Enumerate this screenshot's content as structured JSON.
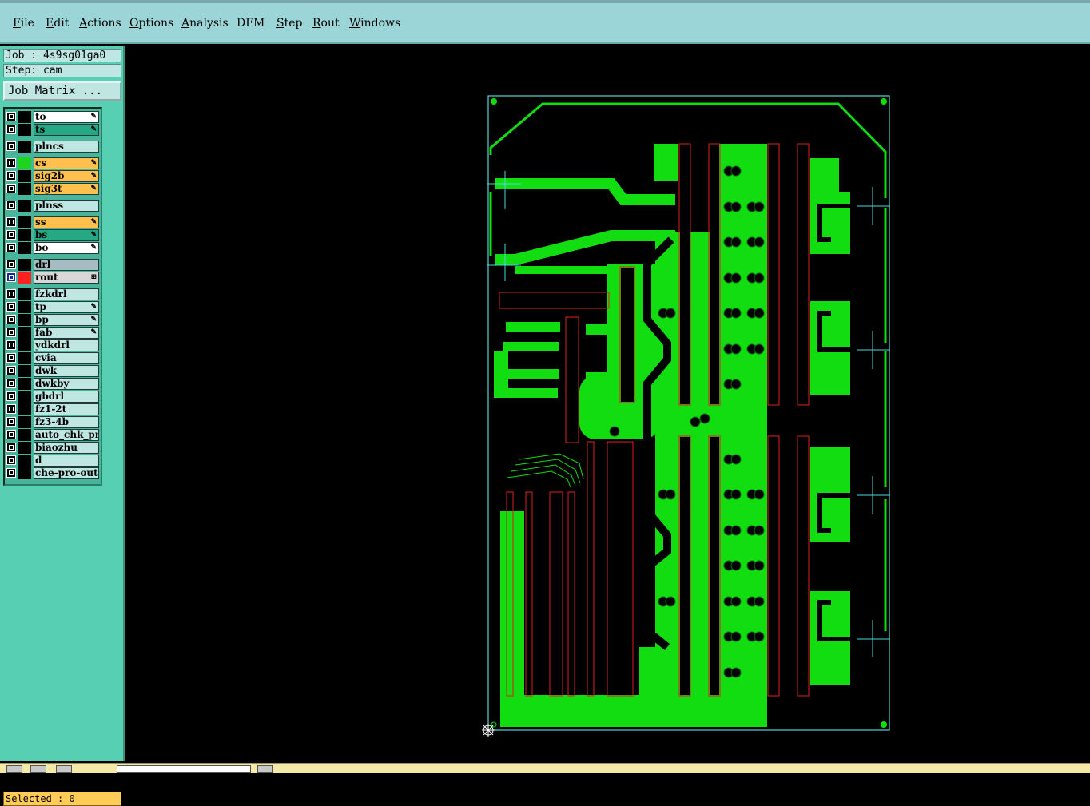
{
  "menubar": {
    "items": [
      {
        "label": "File",
        "accel": "F"
      },
      {
        "label": "Edit",
        "accel": "E"
      },
      {
        "label": "Actions",
        "accel": "A"
      },
      {
        "label": "Options",
        "accel": "O"
      },
      {
        "label": "Analysis",
        "accel": "A"
      },
      {
        "label": "DFM",
        "accel": ""
      },
      {
        "label": "Step",
        "accel": "S"
      },
      {
        "label": "Rout",
        "accel": "R"
      },
      {
        "label": "Windows",
        "accel": "W"
      }
    ]
  },
  "sidebar": {
    "job_label": "Job : 4s9sg01ga0",
    "step_label": "Step: cam",
    "job_matrix_button": "Job Matrix ...",
    "layers": [
      {
        "name": "to",
        "bg": "#ffffff",
        "swatch": "#000000",
        "icon": "pen-icon",
        "group": 0
      },
      {
        "name": "ts",
        "bg": "#27a884",
        "swatch": "#000000",
        "icon": "pen-icon",
        "group": 0
      },
      {
        "name": "plncs",
        "bg": "#bfe6e2",
        "swatch": "#000000",
        "icon": "",
        "group": 1
      },
      {
        "name": "cs",
        "bg": "#ffc04d",
        "swatch": "#1fd41f",
        "icon": "pen-icon",
        "group": 2
      },
      {
        "name": "sig2b",
        "bg": "#ffc04d",
        "swatch": "#000000",
        "icon": "pen-icon",
        "group": 2
      },
      {
        "name": "sig3t",
        "bg": "#ffc04d",
        "swatch": "#000000",
        "icon": "pen-icon",
        "group": 2
      },
      {
        "name": "plnss",
        "bg": "#bfe6e2",
        "swatch": "#000000",
        "icon": "",
        "group": 3
      },
      {
        "name": "ss",
        "bg": "#ffc04d",
        "swatch": "#000000",
        "icon": "pen-icon",
        "group": 4
      },
      {
        "name": "bs",
        "bg": "#27a884",
        "swatch": "#000000",
        "icon": "pen-icon",
        "group": 4
      },
      {
        "name": "bo",
        "bg": "#ffffff",
        "swatch": "#000000",
        "icon": "pen-icon",
        "group": 4
      },
      {
        "name": "drl",
        "bg": "#a6bcc2",
        "swatch": "#000000",
        "icon": "",
        "group": 5
      },
      {
        "name": "rout",
        "bg": "#d8d8d8",
        "swatch": "#ff2020",
        "icon": "grid-icon",
        "group": 5,
        "active": true
      },
      {
        "name": "fzkdrl",
        "bg": "#bfe6e2",
        "swatch": "#000000",
        "icon": "",
        "group": 6
      },
      {
        "name": "tp",
        "bg": "#bfe6e2",
        "swatch": "#000000",
        "icon": "pen-icon",
        "group": 6
      },
      {
        "name": "bp",
        "bg": "#bfe6e2",
        "swatch": "#000000",
        "icon": "pen-icon",
        "group": 6
      },
      {
        "name": "fab",
        "bg": "#bfe6e2",
        "swatch": "#000000",
        "icon": "pen-icon",
        "group": 6
      },
      {
        "name": "ydkdrl",
        "bg": "#bfe6e2",
        "swatch": "#000000",
        "icon": "",
        "group": 6
      },
      {
        "name": "cvia",
        "bg": "#bfe6e2",
        "swatch": "#000000",
        "icon": "",
        "group": 6
      },
      {
        "name": "dwk",
        "bg": "#bfe6e2",
        "swatch": "#000000",
        "icon": "",
        "group": 6
      },
      {
        "name": "dwkby",
        "bg": "#bfe6e2",
        "swatch": "#000000",
        "icon": "",
        "group": 6
      },
      {
        "name": "gbdrl",
        "bg": "#bfe6e2",
        "swatch": "#000000",
        "icon": "",
        "group": 6
      },
      {
        "name": "fz1-2t",
        "bg": "#bfe6e2",
        "swatch": "#000000",
        "icon": "",
        "group": 6
      },
      {
        "name": "fz3-4b",
        "bg": "#bfe6e2",
        "swatch": "#000000",
        "icon": "",
        "group": 6
      },
      {
        "name": "auto_chk_pn.",
        "bg": "#bfe6e2",
        "swatch": "#000000",
        "icon": "",
        "group": 6
      },
      {
        "name": "biaozhu",
        "bg": "#bfe6e2",
        "swatch": "#000000",
        "icon": "",
        "group": 6
      },
      {
        "name": "d",
        "bg": "#bfe6e2",
        "swatch": "#000000",
        "icon": "",
        "group": 6
      },
      {
        "name": "che-pro-out",
        "bg": "#bfe6e2",
        "swatch": "#000000",
        "icon": "",
        "group": 6
      }
    ]
  },
  "status": {
    "selected_label": "Selected : 0"
  },
  "canvas": {
    "copper_color": "#11dd11",
    "outline_color": "#4fd6d6",
    "rout_color": "#dd2020",
    "origin_icon": "origin-crosshair-icon"
  }
}
